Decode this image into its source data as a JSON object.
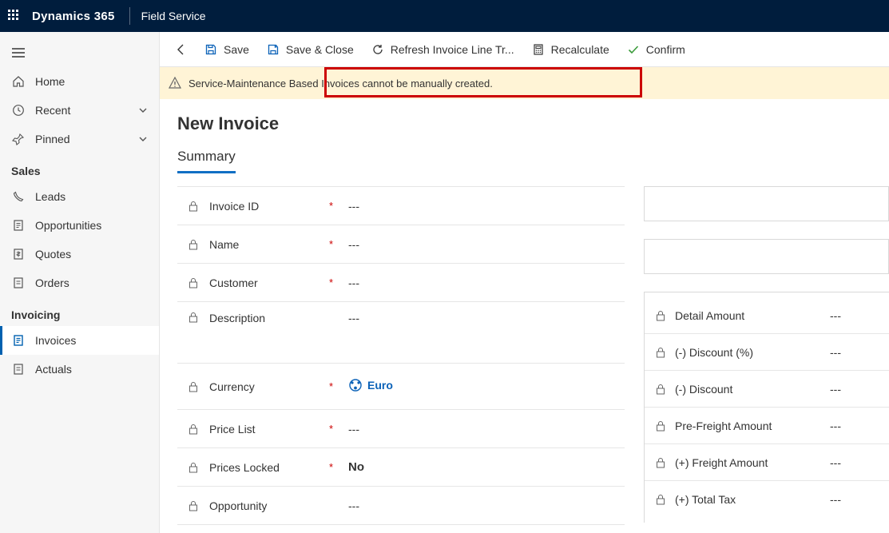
{
  "topbar": {
    "brand": "Dynamics 365",
    "app": "Field Service"
  },
  "sidebar": {
    "nav": {
      "home": "Home",
      "recent": "Recent",
      "pinned": "Pinned"
    },
    "sections": {
      "sales": {
        "title": "Sales",
        "leads": "Leads",
        "opportunities": "Opportunities",
        "quotes": "Quotes",
        "orders": "Orders"
      },
      "invoicing": {
        "title": "Invoicing",
        "invoices": "Invoices",
        "actuals": "Actuals"
      }
    }
  },
  "commands": {
    "save": "Save",
    "saveclose": "Save & Close",
    "refresh": "Refresh Invoice Line Tr...",
    "recalculate": "Recalculate",
    "confirm": "Confirm"
  },
  "warning": "Service-Maintenance Based Invoices cannot be manually created.",
  "page": {
    "title": "New Invoice",
    "tab_summary": "Summary"
  },
  "fields_left": {
    "invoice_id": {
      "label": "Invoice ID",
      "required": true,
      "value": "---"
    },
    "name": {
      "label": "Name",
      "required": true,
      "value": "---"
    },
    "customer": {
      "label": "Customer",
      "required": true,
      "value": "---"
    },
    "description": {
      "label": "Description",
      "required": false,
      "value": "---"
    },
    "currency": {
      "label": "Currency",
      "required": true,
      "value": "Euro"
    },
    "price_list": {
      "label": "Price List",
      "required": true,
      "value": "---"
    },
    "prices_locked": {
      "label": "Prices Locked",
      "required": true,
      "value": "No"
    },
    "opportunity": {
      "label": "Opportunity",
      "required": false,
      "value": "---"
    }
  },
  "fields_right": {
    "detail_amount": {
      "label": "Detail Amount",
      "value": "---"
    },
    "discount_pct": {
      "label": "(-) Discount (%)",
      "value": "---"
    },
    "discount": {
      "label": "(-) Discount",
      "value": "---"
    },
    "pre_freight": {
      "label": "Pre-Freight Amount",
      "value": "---"
    },
    "freight": {
      "label": "(+) Freight Amount",
      "value": "---"
    },
    "total_tax": {
      "label": "(+) Total Tax",
      "value": "---"
    }
  }
}
